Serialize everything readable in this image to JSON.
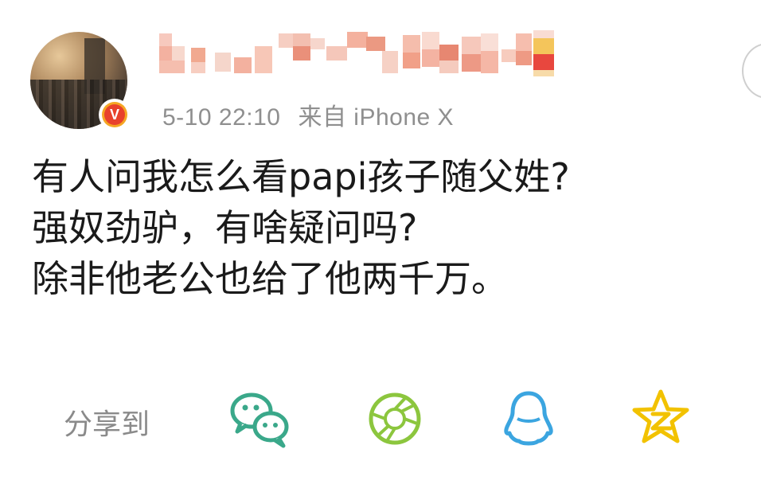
{
  "post": {
    "username_obscured": "pixelated username",
    "timestamp": "5-10 22:10",
    "source": "来自 iPhone X",
    "lines": [
      "有人问我怎么看papi孩子随父姓?",
      "强奴劲驴，有啥疑问吗?",
      "除非他老公也给了他两千万。"
    ]
  },
  "share": {
    "label": "分享到",
    "targets": [
      {
        "name": "wechat",
        "icon": "wechat-icon",
        "color": "#3aa88a"
      },
      {
        "name": "moments",
        "icon": "moments-aperture-icon",
        "color": "#8cc63e"
      },
      {
        "name": "qq",
        "icon": "qq-penguin-icon",
        "color": "#3ba5e0"
      },
      {
        "name": "qzone",
        "icon": "qzone-star-icon",
        "color": "#f2c200"
      }
    ]
  },
  "colors": {
    "text": "#1a1a1a",
    "meta": "#8f8f8f",
    "verified_badge": "#e8412c"
  }
}
